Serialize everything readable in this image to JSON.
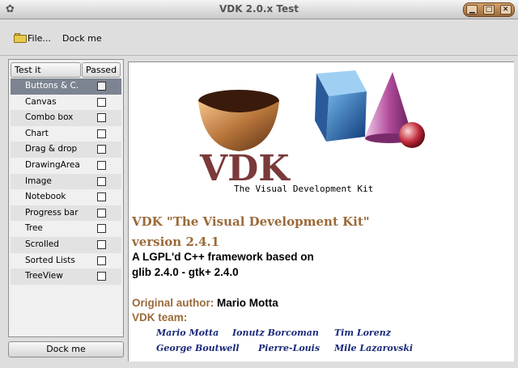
{
  "window": {
    "title": "VDK 2.0.x Test",
    "app_icon": "gnome-foot-icon",
    "controls": [
      "minimize-icon",
      "maximize-icon",
      "close-icon"
    ]
  },
  "toolbar": {
    "file_label": "File...",
    "file_icon": "folder-icon",
    "dock_label": "Dock me"
  },
  "test_list": {
    "columns": [
      "Test it",
      "Passed"
    ],
    "items": [
      {
        "label": "Buttons & C.",
        "selected": true
      },
      {
        "label": "Canvas"
      },
      {
        "label": "Combo box"
      },
      {
        "label": "Chart"
      },
      {
        "label": "Drag & drop"
      },
      {
        "label": "DrawingArea"
      },
      {
        "label": "Image"
      },
      {
        "label": "Notebook"
      },
      {
        "label": "Progress bar"
      },
      {
        "label": "Tree"
      },
      {
        "label": "Scrolled"
      },
      {
        "label": "Sorted Lists"
      },
      {
        "label": "TreeView"
      }
    ],
    "dock_button": "Dock me"
  },
  "about": {
    "logo_text": "VDK",
    "logo_subtitle": "The Visual Development Kit",
    "headline": "VDK \"The Visual Development Kit\"",
    "version": "version 2.4.1",
    "desc_line1": "A LGPL'd C++ framework based on",
    "desc_line2": "glib 2.4.0 - gtk+ 2.4.0",
    "author_key": "Original author:",
    "author_name": "Mario Motta",
    "team_label": "VDK team:",
    "team": [
      "Mario Motta",
      "Ionutz Borcoman",
      "Tim Lorenz",
      "George Boutwell",
      "Pierre-Louis",
      "Mile Lazarovski"
    ]
  },
  "colors": {
    "accent_brown": "#9a6a3a",
    "team_blue": "#1a2a7a",
    "selection": "#7d8491"
  }
}
